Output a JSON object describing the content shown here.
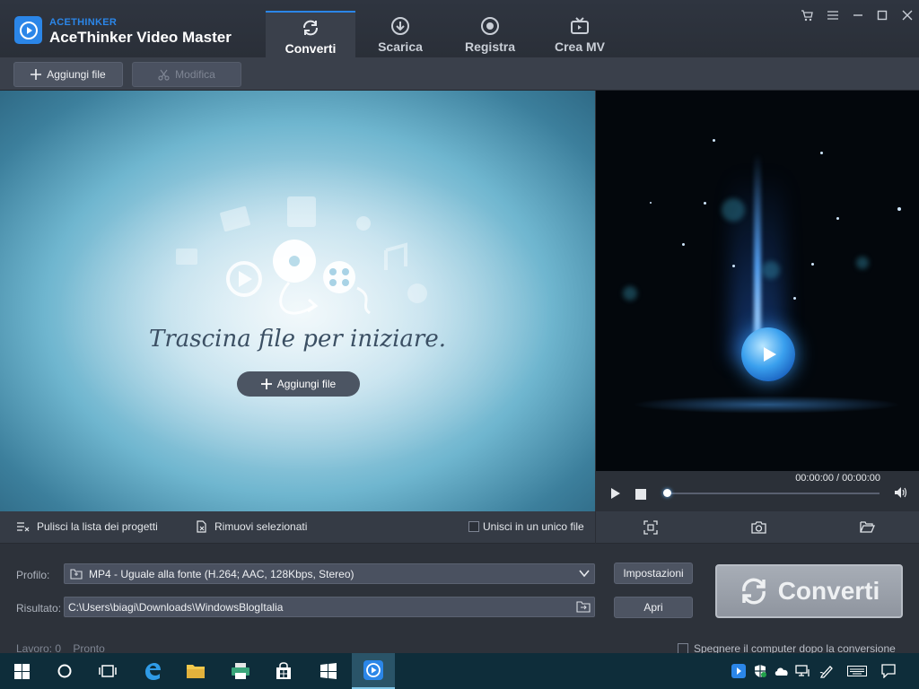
{
  "app": {
    "brand_small": "ACETHINKER",
    "brand_name": "AceThinker Video Master",
    "accent": "#2b86e8"
  },
  "tabs": [
    {
      "label": "Converti",
      "icon": "refresh-icon",
      "active": true
    },
    {
      "label": "Scarica",
      "icon": "download-icon",
      "active": false
    },
    {
      "label": "Registra",
      "icon": "record-icon",
      "active": false
    },
    {
      "label": "Crea MV",
      "icon": "tv-icon",
      "active": false
    }
  ],
  "toolbar": {
    "add_file": "Aggiungi file",
    "edit": "Modifica"
  },
  "droparea": {
    "hint": "Trascina file per iniziare.",
    "add_file": "Aggiungi file"
  },
  "player": {
    "time": "00:00:00 / 00:00:00",
    "progress": 0
  },
  "actions": {
    "clear_list": "Pulisci la lista dei progetti",
    "remove_selected": "Rimuovi selezionati",
    "merge_label": "Unisci in un unico file",
    "merge_checked": false
  },
  "output": {
    "profile_label": "Profilo:",
    "profile_value": "MP4 - Uguale alla fonte (H.264; AAC, 128Kbps, Stereo)",
    "settings_button": "Impostazioni",
    "result_label": "Risultato:",
    "result_path": "C:\\Users\\biagi\\Downloads\\WindowsBlogItalia",
    "open_button": "Apri",
    "convert_button": "Converti"
  },
  "status": {
    "jobs": "Lavoro: 0",
    "state": "Pronto",
    "shutdown_label": "Spegnere il computer dopo la conversione"
  }
}
